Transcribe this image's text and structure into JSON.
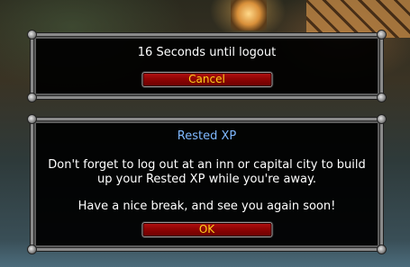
{
  "logout_dialog": {
    "message": "16 Seconds until logout",
    "cancel_label": "Cancel"
  },
  "rested_dialog": {
    "title": "Rested XP",
    "body": "Don't forget to log out at an inn or capital city to build up your Rested XP while you're away.",
    "farewell": "Have a nice break, and see you again soon!",
    "ok_label": "OK"
  },
  "colors": {
    "button_text": "#ffd21a",
    "button_fill": "#8f0404",
    "title_blue": "#7fb8ff",
    "frame_silver": "#8a8a8a"
  }
}
